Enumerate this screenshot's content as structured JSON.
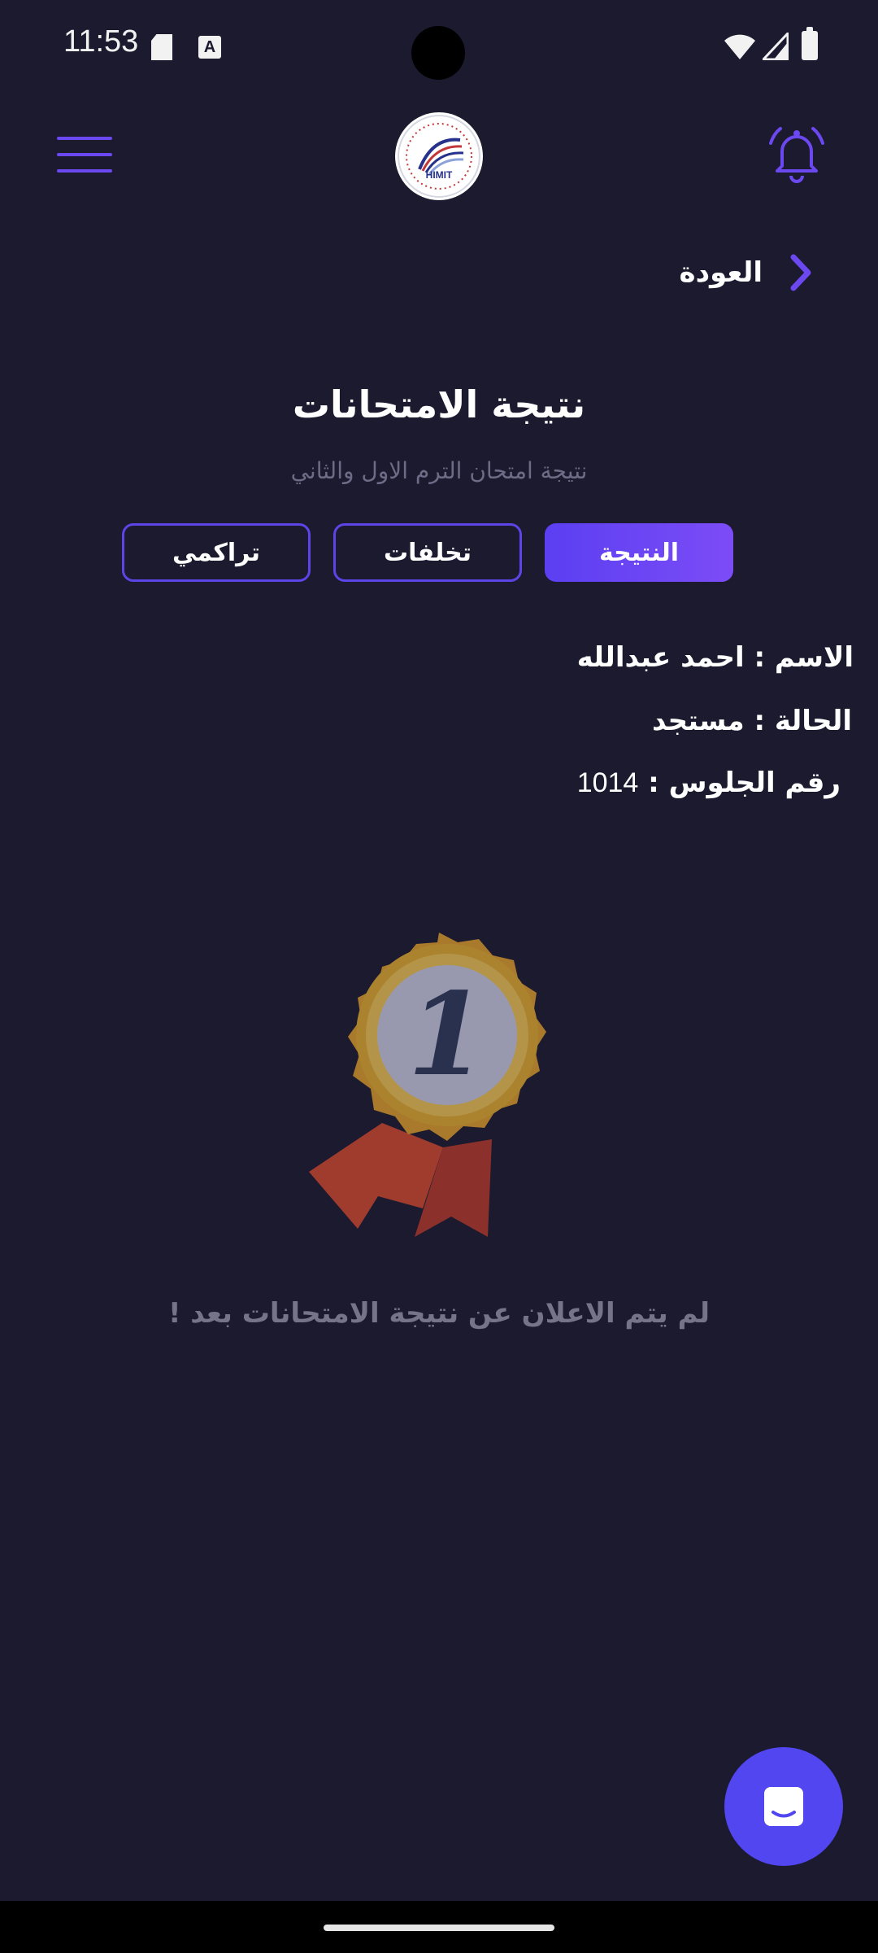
{
  "status_bar": {
    "time": "11:53",
    "icons": [
      "sd-card-icon",
      "a-notification-icon",
      "wifi-icon",
      "cell-signal-icon",
      "battery-icon"
    ]
  },
  "header": {
    "logo_text": "HIMIT",
    "icons": [
      "hamburger-menu-icon",
      "notification-bell-icon"
    ]
  },
  "nav": {
    "back_label": "العودة"
  },
  "page": {
    "title": "نتيجة الامتحانات",
    "subtitle": "نتيجة امتحان الترم الاول والثاني"
  },
  "tabs": [
    {
      "label": "النتيجة",
      "active": true
    },
    {
      "label": "تخلفات",
      "active": false
    },
    {
      "label": "تراكمي",
      "active": false
    }
  ],
  "student": {
    "name_label": "الاسم : ",
    "name_value": "احمد عبدالله",
    "status_label": "الحالة  : ",
    "status_value": "مستجد",
    "seat_label": "رقم الجلوس : ",
    "seat_value": "1014"
  },
  "medal": {
    "number": "1"
  },
  "empty_message": "لم يتم الاعلان عن نتيجة الامتحانات بعد !",
  "colors": {
    "background": "#1b1a2f",
    "accent": "#5b3ff2",
    "fab": "#5146f0",
    "muted_text": "#767489"
  }
}
